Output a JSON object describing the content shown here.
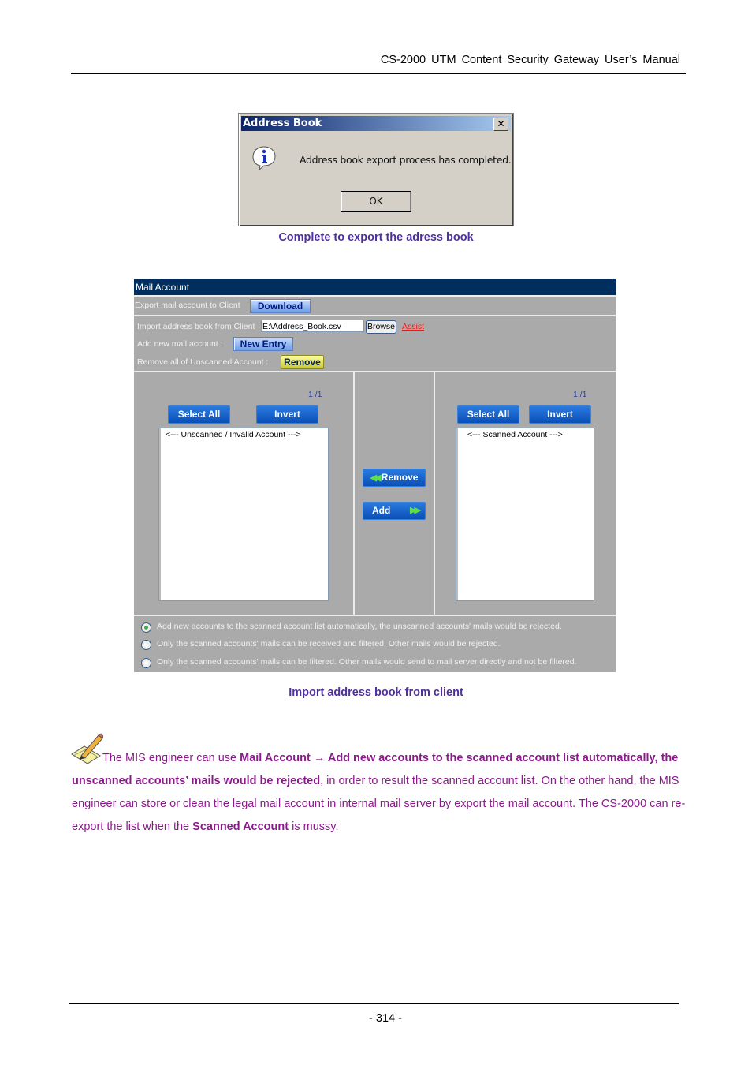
{
  "header": {
    "title": "CS-2000  UTM  Content  Security  Gateway  User’s  Manual"
  },
  "dialog": {
    "title": "Address Book",
    "close_icon": "close-icon",
    "icon": "info-icon",
    "message": "Address book export process has completed.",
    "ok_label": "OK"
  },
  "caption1": "Complete to export the adress book",
  "mail_account": {
    "title": "Mail Account",
    "export_label": "Export mail account to Client",
    "download_label": "Download",
    "import_label": "Import address book from Client",
    "import_value": "E:\\Address_Book.csv",
    "browse_label": "Browse",
    "assist_label": "Assist",
    "add_label": "Add new mail account :",
    "new_entry_label": "New  Entry",
    "remove_all_label": "Remove all of Unscanned Account :",
    "remove_all_btn": "Remove",
    "left": {
      "page": "1 /1",
      "select_all": "Select All",
      "invert": "Invert",
      "list_header": "<--- Unscanned / Invalid Account --->"
    },
    "middle": {
      "remove_label": "Remove",
      "add_label": "Add"
    },
    "right": {
      "page": "1 /1",
      "select_all": "Select All",
      "invert": "Invert",
      "list_header": "<--- Scanned Account --->"
    },
    "options": [
      {
        "label": "Add new accounts to the scanned account list automatically, the unscanned accounts' mails would be rejected.",
        "selected": true
      },
      {
        "label": "Only the scanned accounts' mails can be received and filtered. Other mails would be rejected.",
        "selected": false
      },
      {
        "label": "Only the scanned accounts' mails can be filtered. Other mails would send to mail server directly and not be filtered.",
        "selected": false
      }
    ]
  },
  "caption2": "Import address book from client",
  "note": {
    "icon": "note-pencil-icon",
    "t1": "The MIS engineer can use ",
    "b1": "Mail Account",
    "arrow": " → ",
    "b2": "Add new accounts to the scanned account list automatically, the unscanned accounts’ mails would be rejected",
    "t2": ", in order to result the scanned account list. On the other hand, the MIS engineer can store or clean the legal mail account in internal mail server by export the mail account. The CS-2000 can re-export the list when the ",
    "b3": "Scanned Account",
    "t3": " is mussy."
  },
  "footer": {
    "page_number": "- 314 -"
  }
}
